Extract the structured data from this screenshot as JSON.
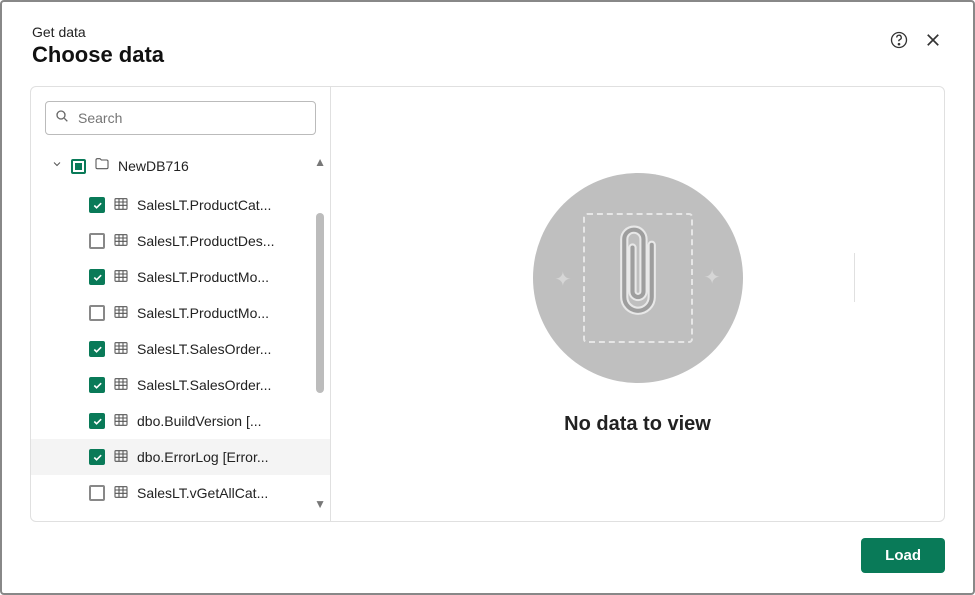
{
  "header": {
    "subtitle": "Get data",
    "title": "Choose data"
  },
  "search": {
    "placeholder": "Search",
    "value": ""
  },
  "tree": {
    "database_name": "NewDB716",
    "items": [
      {
        "label": "SalesLT.ProductCat...",
        "checked": true
      },
      {
        "label": "SalesLT.ProductDes...",
        "checked": false
      },
      {
        "label": "SalesLT.ProductMo...",
        "checked": true
      },
      {
        "label": "SalesLT.ProductMo...",
        "checked": false
      },
      {
        "label": "SalesLT.SalesOrder...",
        "checked": true
      },
      {
        "label": "SalesLT.SalesOrder...",
        "checked": true
      },
      {
        "label": "dbo.BuildVersion [...",
        "checked": true
      },
      {
        "label": "dbo.ErrorLog [Error...",
        "checked": true,
        "hover": true
      },
      {
        "label": "SalesLT.vGetAllCat...",
        "checked": false
      }
    ]
  },
  "main": {
    "empty_text": "No data to view"
  },
  "footer": {
    "load_label": "Load"
  },
  "colors": {
    "accent": "#097a58"
  }
}
